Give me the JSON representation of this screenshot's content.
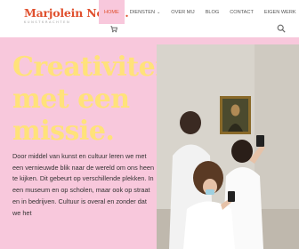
{
  "logo": {
    "name": "Marjolein Nolles.",
    "tagline": "KUNSTKRACHTEN"
  },
  "nav": {
    "items": [
      {
        "label": "HOME"
      },
      {
        "label": "DIENSTEN"
      },
      {
        "label": "OVER MIJ"
      },
      {
        "label": "BLOG"
      },
      {
        "label": "CONTACT"
      },
      {
        "label": "EIGEN WERK"
      }
    ]
  },
  "icons": {
    "cart": "cart-icon",
    "search": "search-icon",
    "dropdown": "chevron-down-icon"
  },
  "hero": {
    "title_lines": [
      "Creativiteit",
      "met een",
      "missie."
    ],
    "paragraph": "Door middel van kunst en cultuur leren we met een vernieuwde blik naar de wereld om ons heen te kijken. Dit gebeurt op verschillende plekken. In een museum en op scholen, maar ook op straat en in bedrijven. Cultuur is overal en zonder dat we het"
  },
  "colors": {
    "accent": "#e0502e",
    "background": "#f8c8dc",
    "title": "#ffe27a"
  }
}
